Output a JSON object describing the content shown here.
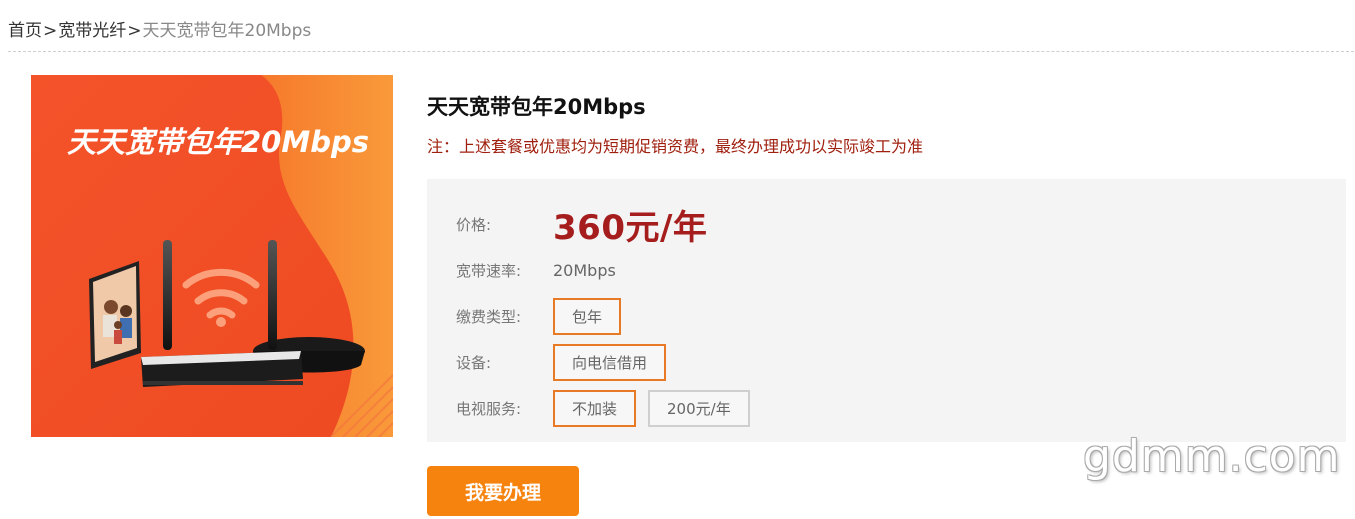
{
  "breadcrumb": {
    "home": "首页",
    "category": "宽带光纤",
    "current": "天天宽带包年20Mbps",
    "separator": ">"
  },
  "product": {
    "image_caption": "天天宽带包年20Mbps",
    "title": "天天宽带包年20Mbps",
    "notice": "注：上述套餐或优惠均为短期促销资费，最终办理成功以实际竣工为准"
  },
  "specs": {
    "price_label": "价格:",
    "price_value": "360元/年",
    "speed_label": "宽带速率:",
    "speed_value": "20Mbps",
    "payment_label": "缴费类型:",
    "payment_options": [
      "包年"
    ],
    "device_label": "设备:",
    "device_options": [
      "向电信借用"
    ],
    "tv_label": "电视服务:",
    "tv_options": [
      "不加装",
      "200元/年"
    ]
  },
  "apply_button": "我要办理",
  "watermark": "gdmm.com",
  "colors": {
    "price": "#a51d1d",
    "notice": "#a0200f",
    "selected_border": "#e87a25",
    "button_bg": "#f7830f",
    "image_bg": "#f05a24"
  },
  "image_icons": [
    "tv-icon",
    "router-icon",
    "wifi-icon",
    "set-top-box-icon"
  ]
}
